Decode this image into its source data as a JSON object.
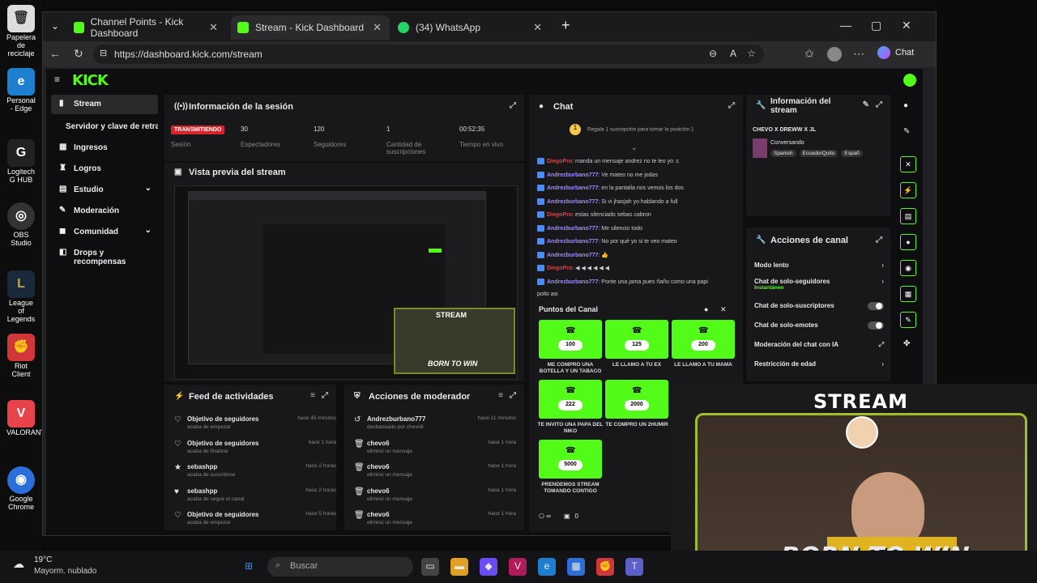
{
  "desktop": {
    "icons": [
      "Papelera de reciclaje",
      "Personal - Edge",
      "Logitech G HUB",
      "OBS Studio",
      "League of Legends",
      "Riot Client",
      "VALORANT",
      "Google Chrome"
    ]
  },
  "browser": {
    "tabs": [
      "Channel Points - Kick Dashboard",
      "Stream - Kick Dashboard",
      "(34) WhatsApp"
    ],
    "url": "https://dashboard.kick.com/stream",
    "chat_btn": "Chat"
  },
  "kick": {
    "logo": "KICK"
  },
  "sidebar": {
    "items": [
      "Stream",
      "Servidor y clave de retransmisión",
      "Ingresos",
      "Logros",
      "Estudio",
      "Moderación",
      "Comunidad",
      "Drops y recompensas"
    ]
  },
  "session": {
    "title": "Información de la sesión",
    "live": "TRANSMITIENDO",
    "live_label": "Sesión",
    "viewers": "30",
    "viewers_label": "Espectadores",
    "followers": "120",
    "followers_label": "Seguidores",
    "subs": "1",
    "subs_label": "Cantidad de suscripciones",
    "time": "00:52:35",
    "time_label": "Tiempo en vivo"
  },
  "preview": {
    "title": "Vista previa del stream"
  },
  "chat": {
    "title": "Chat",
    "pinned": "Regala 1 suscripción para tomar la posición 1",
    "lines": [
      {
        "u": "DiegoPro",
        "t": ": manda un mensaje andrez no te leo yo :c",
        "red": true
      },
      {
        "u": "Andrezburbano777",
        "t": ": Ve mateo no me jodas"
      },
      {
        "u": "Andrezburbano777",
        "t": ": en la pantalla nos vemos los dos"
      },
      {
        "u": "Andrezburbano777",
        "t": ": Si vi jhasjah yo hablando a full"
      },
      {
        "u": "DiegoPro",
        "t": ": estas silenciado sebas cabron",
        "red": true
      },
      {
        "u": "Andrezburbano777",
        "t": ": Me silencio todo"
      },
      {
        "u": "Andrezburbano777",
        "t": ": No por qué yo si te veo mateo"
      },
      {
        "u": "Andrezburbano777",
        "t": ": 👍"
      },
      {
        "u": "DiegoPro",
        "t": ": ◀ ◀ ◀ ◀ ◀ ◀",
        "red": true
      },
      {
        "u": "Andrezburbano777",
        "t": ": Ponte una jama pues ñaño como una papi"
      },
      {
        "u": "",
        "t": "pollo asi"
      }
    ]
  },
  "points": {
    "title": "Puntos del Canal",
    "rewards": [
      {
        "v": "100",
        "l": "ME COMPRO UNA BOTELLA Y UN TABACO"
      },
      {
        "v": "125",
        "l": "LE LLAMO A TU EX"
      },
      {
        "v": "200",
        "l": "LE LLAMO A TU MAMA"
      },
      {
        "v": "222",
        "l": "TE INVITO UNA PAPA DEL NIKO"
      },
      {
        "v": "2000",
        "l": "TE COMPRO UN 2HUMIR"
      },
      {
        "v": "5000",
        "l": "PRENDEMOS STREAM TOMANDO CONTIGO"
      }
    ],
    "footer_count": "0"
  },
  "info": {
    "title": "Información del stream",
    "stream_title": "CHEVO X DREWW X JL",
    "category": "Conversando",
    "tags": [
      "Spanish",
      "EcuadorQuito",
      "Españ"
    ]
  },
  "actions": {
    "title": "Acciones de canal",
    "items": [
      "Modo lento",
      "Chat de solo-seguidores",
      "Chat de solo-suscriptores",
      "Chat de solo-emotes",
      "Moderación del chat con IA",
      "Restricción de edad"
    ],
    "followers_sub": "Instantáneo"
  },
  "feed": {
    "title": "Feed de actividades",
    "items": [
      {
        "t": "Objetivo de seguidores",
        "s": "acaba de empezar",
        "w": "hace 45 minutos"
      },
      {
        "t": "Objetivo de seguidores",
        "s": "acaba de finalizar",
        "w": "hace 1 hora"
      },
      {
        "t": "sebashpp",
        "s": "acaba de suscribirse",
        "w": "hace 2 horas"
      },
      {
        "t": "sebashpp",
        "s": "acaba de seguir el canal",
        "w": "hace 2 horas"
      },
      {
        "t": "Objetivo de seguidores",
        "s": "acaba de empezar",
        "w": "hace 5 horas"
      }
    ]
  },
  "mod": {
    "title": "Acciones de moderador",
    "items": [
      {
        "t": "Andrezburbano777",
        "s": "desbaneado por chevo6",
        "w": "hace 11 minutos"
      },
      {
        "t": "chevo6",
        "s": "eliminó un mensaje",
        "w": "hace 1 hora"
      },
      {
        "t": "chevo6",
        "s": "eliminó un mensaje",
        "w": "hace 1 hora"
      },
      {
        "t": "chevo6",
        "s": "eliminó un mensaje",
        "w": "hace 1 hora"
      },
      {
        "t": "chevo6",
        "s": "eliminó un mensaje",
        "w": "hace 1 hora"
      }
    ]
  },
  "overlay": {
    "top": "STREAM",
    "bottom": "BORN TO WIN"
  },
  "taskbar": {
    "temp": "19°C",
    "weather": "Mayorm. nublado",
    "search": "Buscar"
  }
}
